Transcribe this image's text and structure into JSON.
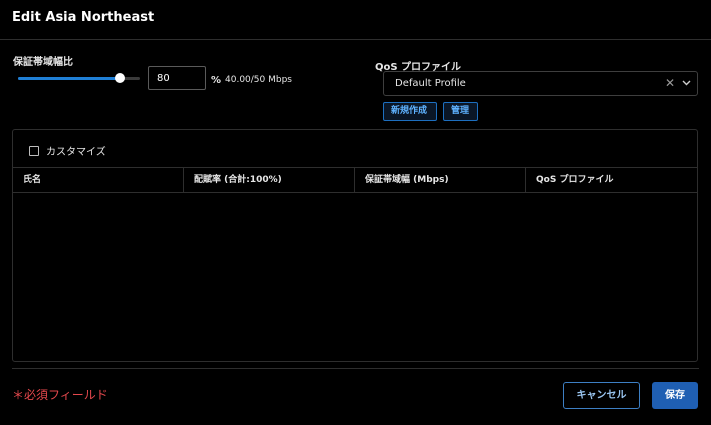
{
  "dialog": {
    "title": "Edit Asia Northeast"
  },
  "bandwidth": {
    "label": "保証帯域幅比",
    "value": "80",
    "percent": 80,
    "unit": "%",
    "rate": "40.00/50 Mbps"
  },
  "qos": {
    "label": "QoS プロファイル",
    "selected": "Default Profile",
    "new_button": "新規作成",
    "manage_button": "管理"
  },
  "panel": {
    "customize_label": "カスタマイズ",
    "customize_checked": false,
    "columns": [
      "氏名",
      "配賦率 (合計:100%)",
      "保証帯域幅 (Mbps)",
      "QoS プロファイル"
    ],
    "rows": []
  },
  "footer": {
    "required_note": "＊必須フィールド",
    "cancel_label": "キャンセル",
    "save_label": "保存"
  },
  "colors": {
    "accent": "#1f7fd6",
    "primary_button": "#1f5fb3",
    "required": "#e5484d",
    "background": "#000000"
  }
}
